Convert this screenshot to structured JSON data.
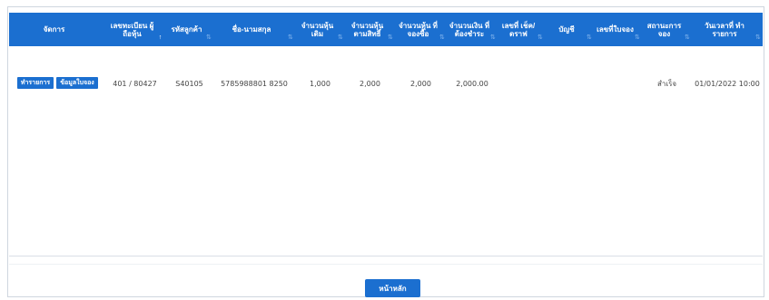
{
  "table": {
    "headers": [
      {
        "label": "จัดการ",
        "sort": ""
      },
      {
        "label": "เลขทะเบียน ผู้ถือหุ้น",
        "sort": "↑"
      },
      {
        "label": "รหัสลูกค้า",
        "sort": "⇅"
      },
      {
        "label": "ชื่อ-นามสกุล",
        "sort": "⇅"
      },
      {
        "label": "จำนวนหุ้น เดิม",
        "sort": "⇅"
      },
      {
        "label": "จำนวนหุ้น ตามสิทธิ์",
        "sort": "⇅"
      },
      {
        "label": "จำนวนหุ้น ที่จองซื้อ",
        "sort": "⇅"
      },
      {
        "label": "จำนวนเงิน ที่ต้องชำระ",
        "sort": "⇅"
      },
      {
        "label": "เลขที่ เช็ค/ดราฟ",
        "sort": "⇅"
      },
      {
        "label": "บัญชี",
        "sort": "⇅"
      },
      {
        "label": "เลขที่ใบจอง",
        "sort": "⇅"
      },
      {
        "label": "สถานะการจอง",
        "sort": "⇅"
      },
      {
        "label": "วันเวลาที่ ทำรายการ",
        "sort": "⇅"
      }
    ],
    "rows": [
      {
        "buttons": [
          "ทำรายการ",
          "ข้อมูลใบจอง"
        ],
        "holder_id": "401 / 80427",
        "customer_code": "S40105",
        "name": "5785988801 8250",
        "old_shares": "1,000",
        "entitled_shares": "2,000",
        "subscribed_shares": "2,000",
        "amount": "2,000.00",
        "cheque_no": "",
        "account": "",
        "booking_no": "",
        "status": "สำเร็จ",
        "datetime": "01/01/2022 10:00"
      }
    ]
  },
  "footer": {
    "back_label": "หน้าหลัก"
  },
  "colors": {
    "header_bg": "#1b6fd0",
    "button_bg": "#1b6fd0"
  }
}
